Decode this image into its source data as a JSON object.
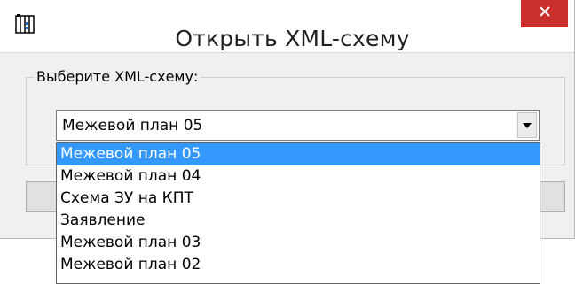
{
  "window": {
    "title": "Открыть XML-схему",
    "app_icon": "file-cabinet-icon",
    "close_icon": "close-icon",
    "close_color": "#c7302b"
  },
  "group": {
    "label": "Выберите XML-схему:"
  },
  "combo": {
    "selected_value": "Межевой план 05",
    "arrow_icon": "chevron-down-icon"
  },
  "dropdown": {
    "highlight_color": "#3399ff",
    "options": [
      "Межевой план 05",
      "Межевой план 04",
      "Схема ЗУ на КПТ",
      "Заявление",
      "Межевой план 03",
      "Межевой план 02"
    ],
    "selected_index": 0
  }
}
